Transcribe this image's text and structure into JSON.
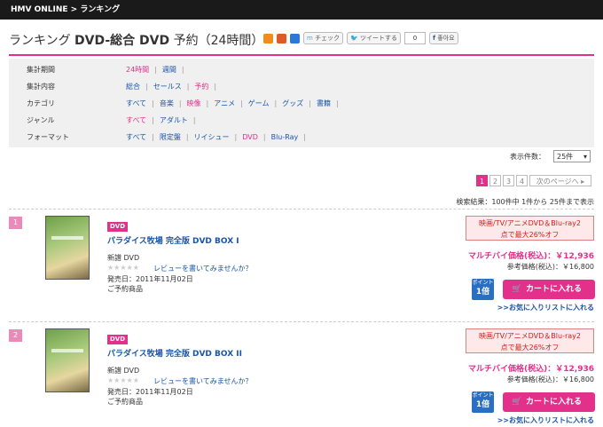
{
  "topbar": {
    "breadcrumb": "HMV ONLINE > ランキング"
  },
  "header": {
    "title_prefix": "ランキング ",
    "title_bold": "DVD-総合 DVD",
    "title_suffix": " 予約（24時間）",
    "check_label": "チェック",
    "tweet_label": "ツイートする",
    "tweet_count": "0",
    "like_label": "좋아요"
  },
  "filters": [
    {
      "label": "集計期間",
      "options": [
        "24時間",
        "週間"
      ],
      "selected": "24時間"
    },
    {
      "label": "集計内容",
      "options": [
        "総合",
        "セールス",
        "予約"
      ],
      "selected": "予約"
    },
    {
      "label": "カテゴリ",
      "options": [
        "すべて",
        "音楽",
        "映像",
        "アニメ",
        "ゲーム",
        "グッズ",
        "書籍"
      ],
      "selected": "映像"
    },
    {
      "label": "ジャンル",
      "options": [
        "すべて",
        "アダルト"
      ],
      "selected": "すべて"
    },
    {
      "label": "フォーマット",
      "options": [
        "すべて",
        "限定盤",
        "リイシュー",
        "DVD",
        "Blu-Ray"
      ],
      "selected": "DVD"
    }
  ],
  "display": {
    "label": "表示件数：",
    "value": "25件"
  },
  "pager": {
    "pages": [
      "1",
      "2",
      "3",
      "4"
    ],
    "current": "1",
    "next": "次のページへ"
  },
  "results": "検索結果：100件中 1件から 25件まで表示",
  "items": [
    {
      "rank": "1",
      "format": "DVD",
      "title": "パラダイス牧場 完全版 DVD BOX I",
      "type": "新譜 DVD",
      "review": "レビューを書いてみませんか？",
      "date": "発売日：2011年11月02日",
      "status": "ご予約商品",
      "promo_line1": "映画/TV/アニメDVD＆Blu-ray2",
      "promo_line2": "点で最大26%オフ",
      "multi_price": "マルチバイ価格(税込)：￥12,936",
      "ref_price": "参考価格(税込)：￥16,800",
      "point_label": "ポイント",
      "point_value": "1倍",
      "cart_label": "カートに入れる",
      "fav_label": ">>お気に入りリストに入れる"
    },
    {
      "rank": "2",
      "format": "DVD",
      "title": "パラダイス牧場 完全版 DVD BOX II",
      "type": "新譜 DVD",
      "review": "レビューを書いてみませんか？",
      "date": "発売日：2011年11月02日",
      "status": "ご予約商品",
      "promo_line1": "映画/TV/アニメDVD＆Blu-ray2",
      "promo_line2": "点で最大26%オフ",
      "multi_price": "マルチバイ価格(税込)：￥12,936",
      "ref_price": "参考価格(税込)：￥16,800",
      "point_label": "ポイント",
      "point_value": "1倍",
      "cart_label": "カートに入れる",
      "fav_label": ">>お気に入りリストに入れる"
    }
  ],
  "colors": {
    "accent": "#e3308a",
    "link": "#1a55a8",
    "promo": "#d02020"
  }
}
